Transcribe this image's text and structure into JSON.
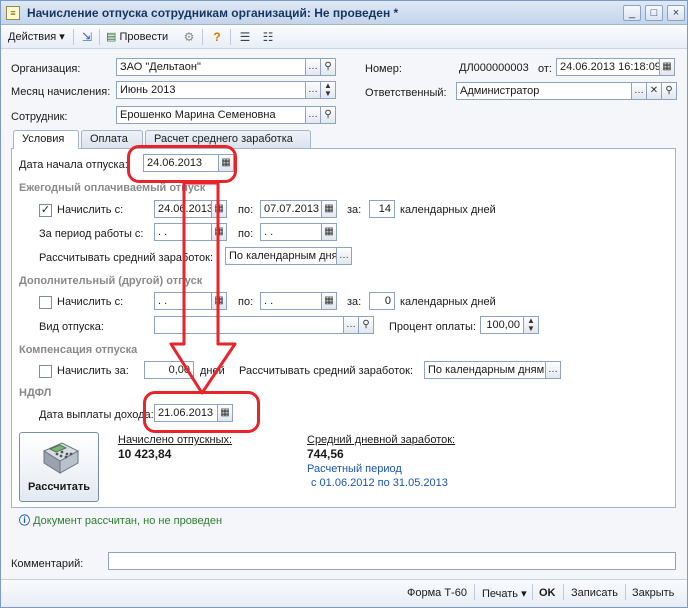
{
  "window": {
    "title": "Начисление отпуска сотрудникам организаций: Не проведен *",
    "minimize": "_",
    "maximize": "□",
    "close": "×"
  },
  "toolbar": {
    "actions": "Действия",
    "post": "Провести"
  },
  "header": {
    "org_label": "Организация:",
    "org_value": "ЗАО \"Дельтаон\"",
    "month_label": "Месяц начисления:",
    "month_value": "Июнь 2013",
    "employee_label": "Сотрудник:",
    "employee_value": "Ерошенко Марина Семеновна",
    "number_label": "Номер:",
    "number_value": "ДЛ000000003",
    "from_label": "от:",
    "date_value": "24.06.2013 16:18:09",
    "responsible_label": "Ответственный:",
    "responsible_value": "Администратор"
  },
  "tabs": [
    "Условия",
    "Оплата",
    "Расчет среднего заработка"
  ],
  "conditions": {
    "start_label": "Дата начала отпуска:",
    "start_value": "24.06.2013",
    "annual_section": "Ежегодный оплачиваемый отпуск",
    "annual_accrue_label": "Начислить с:",
    "annual_from": "24.06.2013",
    "to_label": "по:",
    "annual_to": "07.07.2013",
    "for_label": "за:",
    "annual_days": "14",
    "days_label": "календарных дней",
    "work_period_label": "За период работы с:",
    "work_from": " .  .",
    "work_to": " .  .",
    "avg_label": "Рассчитывать средний заработок:",
    "avg_value": "По календарным дням",
    "extra_section": "Дополнительный (другой) отпуск",
    "extra_accrue_label": "Начислить с:",
    "extra_from": " .  .",
    "extra_to": " .  .",
    "extra_days": "0",
    "leave_type_label": "Вид отпуска:",
    "leave_type_value": "",
    "pay_percent_label": "Процент оплаты:",
    "pay_percent_value": "100,00",
    "comp_section": "Компенсация отпуска",
    "comp_accrue_label": "Начислить за:",
    "comp_days": "0,00",
    "comp_days_label": "дней",
    "comp_avg_label": "Рассчитывать средний заработок:",
    "comp_avg_value": "По календарным дням",
    "ndfl_section": "НДФЛ",
    "pay_date_label": "Дата выплаты дохода:",
    "pay_date_value": "21.06.2013",
    "calc_button": "Рассчитать",
    "accrued_label": "Начислено отпускных:",
    "accrued_value": "10 423,84",
    "avg_daily_label": "Средний дневной заработок:",
    "avg_daily_value": "744,56",
    "period_label": "Расчетный период",
    "period_value": "с 01.06.2012 по 31.05.2013"
  },
  "status": "Документ рассчитан, но не проведен",
  "comment_label": "Комментарий:",
  "comment_value": "",
  "bottom": {
    "form": "Форма Т-60",
    "print": "Печать",
    "ok": "OK",
    "save": "Записать",
    "close": "Закрыть"
  }
}
